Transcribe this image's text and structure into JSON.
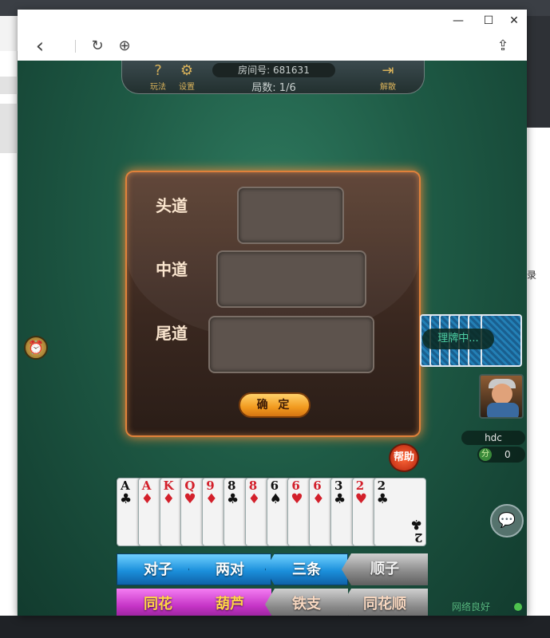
{
  "browser": {
    "minimize_glyph": "—",
    "maximize_glyph": "☐",
    "close_glyph": "✕",
    "back_glyph": "‹",
    "reload_glyph": "↻",
    "globe_glyph": "⊕",
    "share_glyph": "⇪"
  },
  "top_panel": {
    "help_label": "玩法",
    "settings_label": "设置",
    "room_label": "房间号: 681631",
    "round_label": "局数: 1/6",
    "dismiss_label": "解散"
  },
  "dialog": {
    "rows": [
      "头道",
      "中道",
      "尾道"
    ],
    "confirm_label": "确 定"
  },
  "opponent": {
    "status": "理牌中...",
    "name": "hdc",
    "score_icon": "分",
    "score": "0"
  },
  "help_button": "帮助",
  "hand": [
    {
      "rank": "A",
      "suit": "♣",
      "color": "black"
    },
    {
      "rank": "A",
      "suit": "♦",
      "color": "red"
    },
    {
      "rank": "K",
      "suit": "♦",
      "color": "red"
    },
    {
      "rank": "Q",
      "suit": "♥",
      "color": "red"
    },
    {
      "rank": "9",
      "suit": "♦",
      "color": "red"
    },
    {
      "rank": "8",
      "suit": "♣",
      "color": "black"
    },
    {
      "rank": "8",
      "suit": "♦",
      "color": "red"
    },
    {
      "rank": "6",
      "suit": "♠",
      "color": "black"
    },
    {
      "rank": "6",
      "suit": "♥",
      "color": "red"
    },
    {
      "rank": "6",
      "suit": "♦",
      "color": "red"
    },
    {
      "rank": "3",
      "suit": "♣",
      "color": "black"
    },
    {
      "rank": "2",
      "suit": "♥",
      "color": "red"
    },
    {
      "rank": "2",
      "suit": "♣",
      "color": "black"
    }
  ],
  "combos_row1": [
    "对子",
    "两对",
    "三条",
    "顺子"
  ],
  "combos_row2": [
    "同花",
    "葫芦",
    "铁支",
    "同花顺"
  ],
  "network": "网络良好",
  "desktop": {
    "right_text": "录"
  }
}
